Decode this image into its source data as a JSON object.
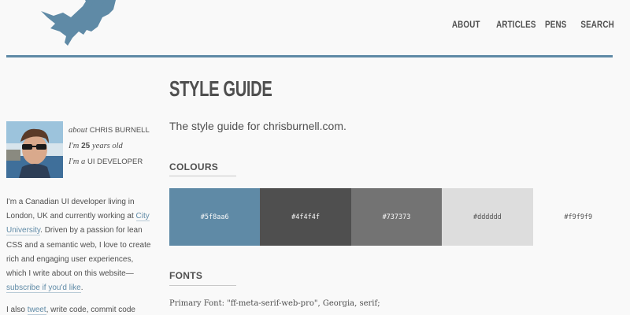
{
  "nav": {
    "items": [
      "ABOUT",
      "ARTICLES",
      "PENS",
      "SEARCH"
    ]
  },
  "page_title": "STYLE GUIDE",
  "sidebar": {
    "about_prefix": "about",
    "name": "CHRIS BURNELL",
    "age_prefix": "I'm",
    "age": "25",
    "age_suffix": "years old",
    "role_prefix": "I'm a",
    "role": "UI DEVELOPER",
    "bio_part1": "I'm a Canadian UI developer living in London, UK and currently working at ",
    "bio_link1": "City University",
    "bio_part2": ". Driven by a passion for lean CSS and a semantic web, I love to create rich and engaging user experiences, which I write about on this website—",
    "bio_link2": "subscribe if you'd like",
    "bio_part3": ".",
    "bio2_part1": "I also ",
    "bio2_link": "tweet",
    "bio2_part2": ", write code, commit code"
  },
  "intro": "The style guide for chrisburnell.com.",
  "colours": {
    "heading": "COLOURS",
    "swatches": [
      {
        "label": "#5f8aa6",
        "bg": "#5f8aa6",
        "fg": "#f9f9f9"
      },
      {
        "label": "#4f4f4f",
        "bg": "#4f4f4f",
        "fg": "#f9f9f9"
      },
      {
        "label": "#737373",
        "bg": "#737373",
        "fg": "#f9f9f9"
      },
      {
        "label": "#dddddd",
        "bg": "#dddddd",
        "fg": "#4f4f4f"
      },
      {
        "label": "#f9f9f9",
        "bg": "#f9f9f9",
        "fg": "#4f4f4f"
      }
    ]
  },
  "fonts": {
    "heading": "FONTS",
    "primary": "Primary Font: \"ff-meta-serif-web-pro\", Georgia, serif;"
  }
}
